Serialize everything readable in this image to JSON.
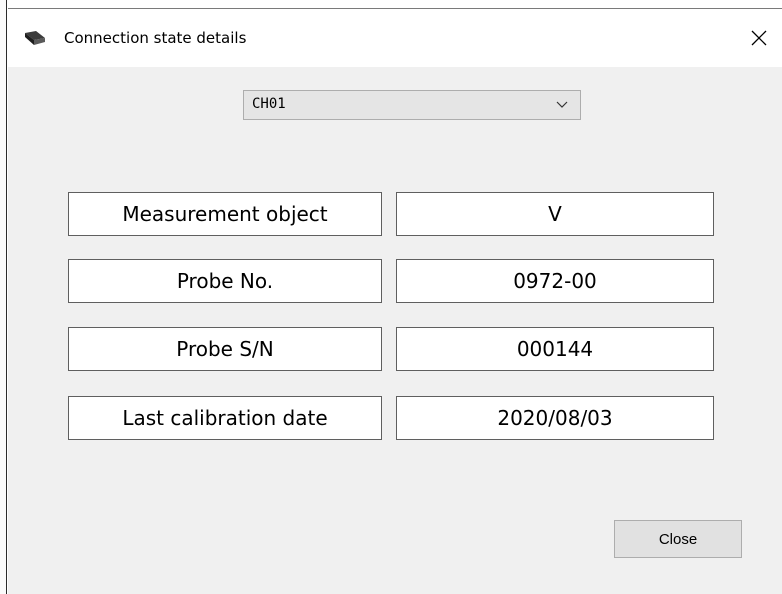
{
  "window": {
    "title": "Connection state details",
    "icon": "probe-app-icon",
    "close_glyph": "✕"
  },
  "channel_select": {
    "selected": "CH01",
    "icon": "chevron-down-icon"
  },
  "details": {
    "rows": [
      {
        "label": "Measurement object",
        "value": "V"
      },
      {
        "label": "Probe No.",
        "value": "0972-00"
      },
      {
        "label": "Probe S/N",
        "value": "000144"
      },
      {
        "label": "Last calibration date",
        "value": "2020/08/03"
      }
    ]
  },
  "footer": {
    "close_label": "Close"
  }
}
